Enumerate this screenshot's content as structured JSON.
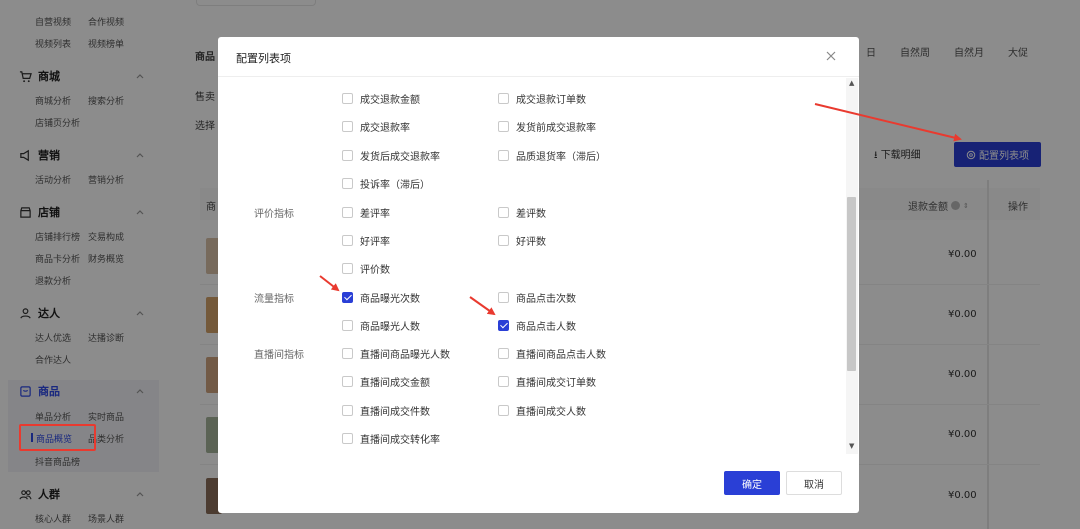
{
  "sidebar": {
    "top_links": [
      "自营视频",
      "合作视频",
      "视频列表",
      "视频榜单"
    ],
    "sections": [
      {
        "title": "商城",
        "icon": "cart-icon",
        "items": [
          "商城分析",
          "搜索分析",
          "店铺页分析"
        ]
      },
      {
        "title": "营销",
        "icon": "megaphone-icon",
        "items": [
          "活动分析",
          "营销分析"
        ]
      },
      {
        "title": "店铺",
        "icon": "store-icon",
        "items": [
          "店铺排行榜",
          "交易构成",
          "商品卡分析",
          "财务概览",
          "退款分析"
        ]
      },
      {
        "title": "达人",
        "icon": "person-icon",
        "items": [
          "达人优选",
          "达播诊断",
          "合作达人"
        ]
      },
      {
        "title": "商品",
        "icon": "goods-icon",
        "items": [
          "单品分析",
          "实时商品",
          "商品概览",
          "品类分析",
          "抖音商品榜"
        ]
      },
      {
        "title": "人群",
        "icon": "people-icon",
        "items": [
          "核心人群",
          "场景人群"
        ]
      }
    ],
    "active_item": "商品概览"
  },
  "background": {
    "time_tabs": [
      "日",
      "自然周",
      "自然月",
      "大促"
    ],
    "label_goods": "商品",
    "label_sell": "售卖",
    "label_select": "选择",
    "label_header": "商",
    "download_label": "下载明细",
    "config_label": "配置列表项",
    "col_refund": "退款金额",
    "col_op": "操作",
    "row_values": [
      "¥0.00",
      "¥0.00",
      "¥0.00",
      "¥0.00",
      "¥0.00"
    ]
  },
  "modal": {
    "title": "配置列表项",
    "ok_label": "确定",
    "cancel_label": "取消",
    "groups": [
      {
        "label": "",
        "rows": [
          [
            {
              "text": "成交退款金额",
              "checked": false
            },
            {
              "text": "成交退款订单数",
              "checked": false
            }
          ],
          [
            {
              "text": "成交退款率",
              "checked": false
            },
            {
              "text": "发货前成交退款率",
              "checked": false
            }
          ],
          [
            {
              "text": "发货后成交退款率",
              "checked": false
            },
            {
              "text": "品质退货率（滞后）",
              "checked": false
            }
          ],
          [
            {
              "text": "投诉率（滞后）",
              "checked": false
            }
          ]
        ]
      },
      {
        "label": "评价指标",
        "rows": [
          [
            {
              "text": "差评率",
              "checked": false
            },
            {
              "text": "差评数",
              "checked": false
            }
          ],
          [
            {
              "text": "好评率",
              "checked": false
            },
            {
              "text": "好评数",
              "checked": false
            }
          ],
          [
            {
              "text": "评价数",
              "checked": false
            }
          ]
        ]
      },
      {
        "label": "流量指标",
        "rows": [
          [
            {
              "text": "商品曝光次数",
              "checked": true
            },
            {
              "text": "商品点击次数",
              "checked": false
            }
          ],
          [
            {
              "text": "商品曝光人数",
              "checked": false
            },
            {
              "text": "商品点击人数",
              "checked": true
            }
          ]
        ]
      },
      {
        "label": "直播间指标",
        "rows": [
          [
            {
              "text": "直播间商品曝光人数",
              "checked": false
            },
            {
              "text": "直播间商品点击人数",
              "checked": false
            }
          ],
          [
            {
              "text": "直播间成交金额",
              "checked": false
            },
            {
              "text": "直播间成交订单数",
              "checked": false
            }
          ],
          [
            {
              "text": "直播间成交件数",
              "checked": false
            },
            {
              "text": "直播间成交人数",
              "checked": false
            }
          ],
          [
            {
              "text": "直播间成交转化率",
              "checked": false
            }
          ]
        ]
      }
    ]
  },
  "colors": {
    "primary": "#2a3fd6",
    "annotation_red": "#e93a2f",
    "overlay": "rgba(0,0,0,0.45)"
  }
}
